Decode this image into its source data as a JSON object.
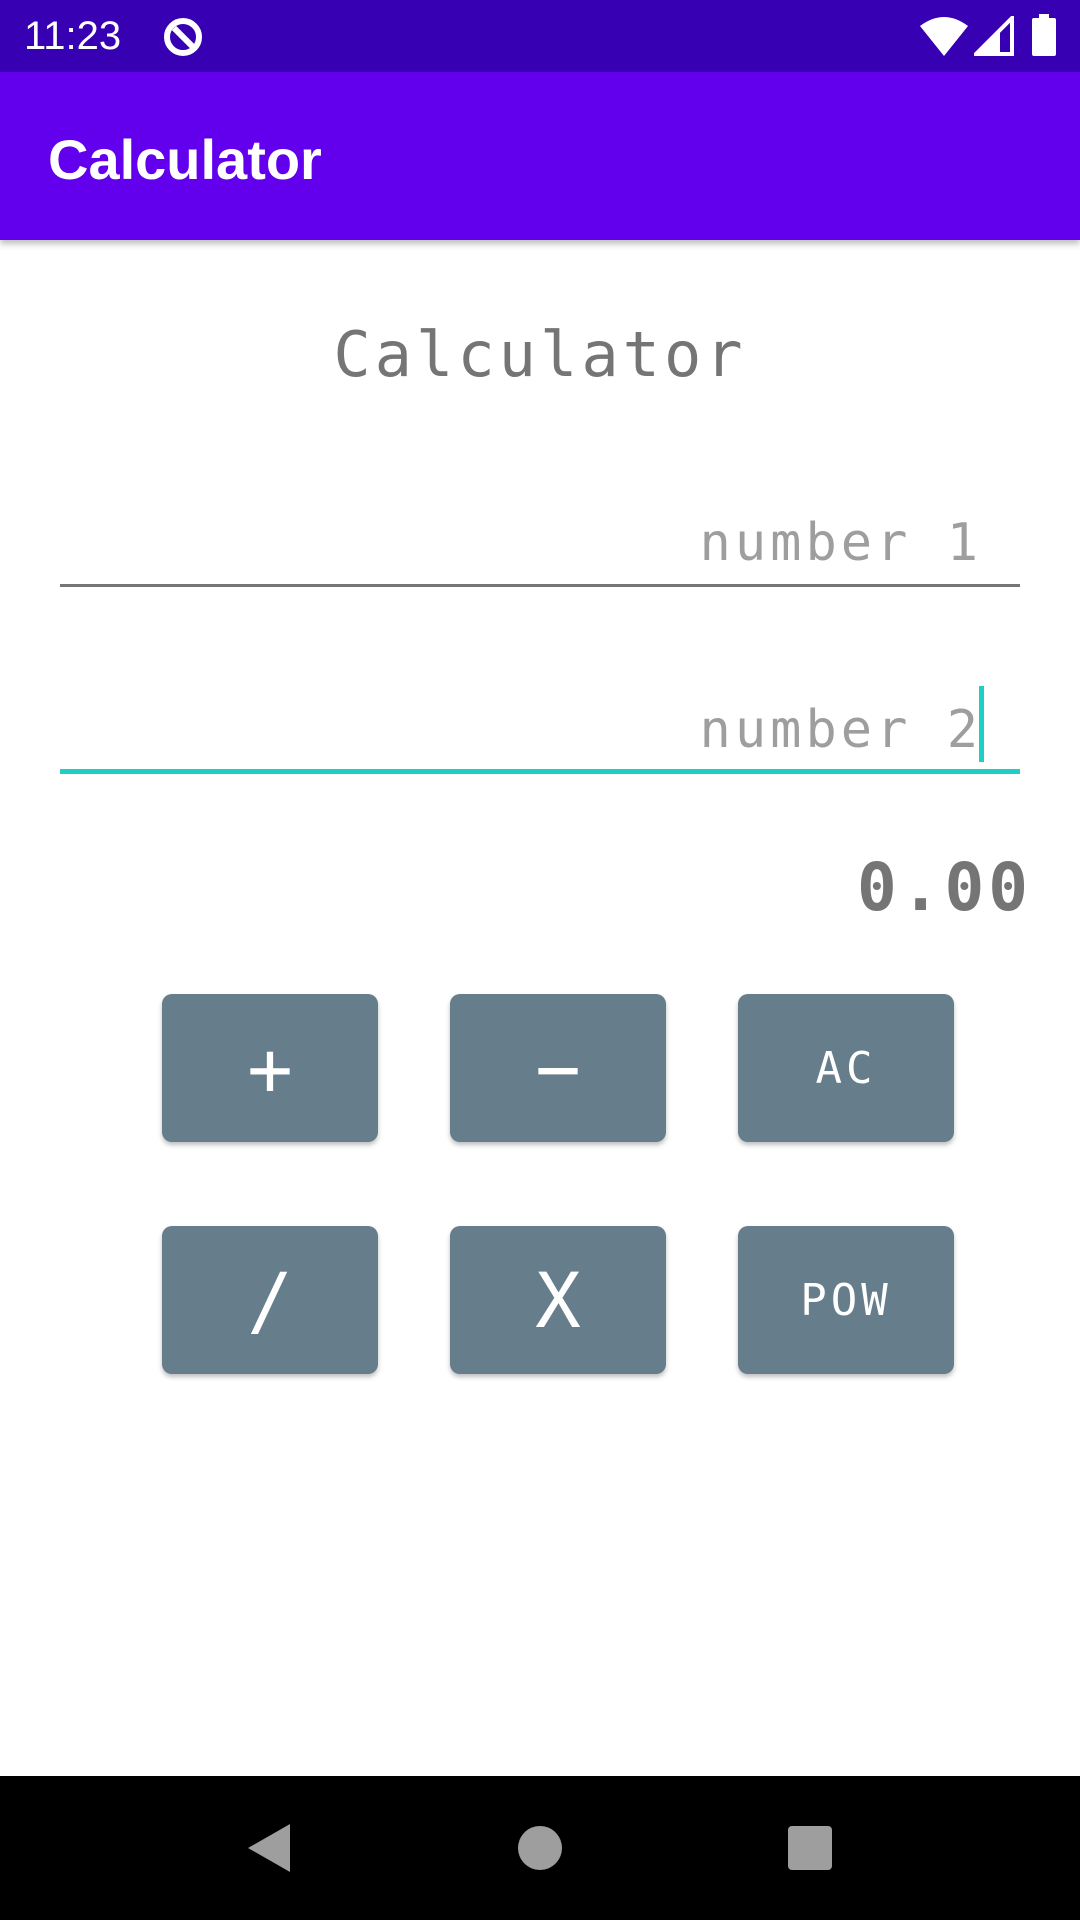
{
  "status_bar": {
    "time": "11:23",
    "icons": [
      "app-notification-icon",
      "wifi-icon",
      "signal-icon",
      "battery-icon"
    ]
  },
  "app_bar": {
    "title": "Calculator",
    "color": "#6200EE"
  },
  "main": {
    "title": "Calculator",
    "number1": {
      "value": "",
      "placeholder": "number 1"
    },
    "number2": {
      "value": "",
      "placeholder": "number 2",
      "focused": true
    },
    "result": "0.00",
    "buttons": {
      "plus": "+",
      "minus": "−",
      "ac": "AC",
      "divide": "/",
      "multiply": "X",
      "pow": "POW"
    },
    "button_color": "#667D8B",
    "accent_color": "#1DCFC5"
  },
  "nav_bar": {
    "icons": [
      "back-icon",
      "home-icon",
      "recents-icon"
    ]
  }
}
